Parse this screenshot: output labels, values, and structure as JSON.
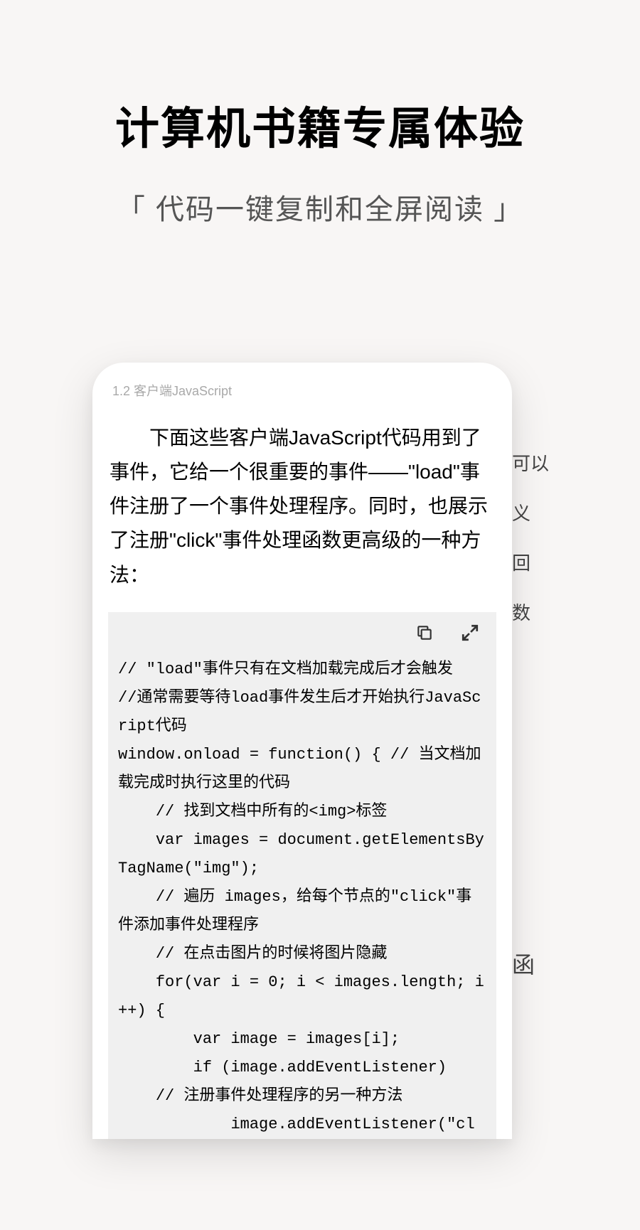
{
  "hero": {
    "title": "计算机书籍专属体验",
    "subtitle": "「 代码一键复制和全屏阅读 」"
  },
  "reader": {
    "chapter": "1.2 客户端JavaScript",
    "paragraph": "下面这些客户端JavaScript代码用到了事件，它给一个很重要的事件——\"load\"事件注册了一个事件处理程序。同时，也展示了注册\"click\"事件处理函数更高级的一种方法：",
    "code": "// \"load\"事件只有在文档加载完成后才会触发\n//通常需要等待load事件发生后才开始执行JavaScript代码\nwindow.onload = function() { // 当文档加载完成时执行这里的代码\n    // 找到文档中所有的<img>标签\n    var images = document.getElementsByTagName(\"img\");\n    // 遍历 images，给每个节点的\"click\"事件添加事件处理程序\n    // 在点击图片的时候将图片隐藏\n    for(var i = 0; i < images.length; i++) {\n        var image = images[i];\n        if (image.addEventListener)\n    // 注册事件处理程序的另一种方法\n            image.addEventListener(\"cl"
  },
  "background": {
    "text1": "可以",
    "text2": "义",
    "text3": "回",
    "text4": "数",
    "text5": "函"
  },
  "icons": {
    "copy": "copy-icon",
    "fullscreen": "fullscreen-icon"
  }
}
